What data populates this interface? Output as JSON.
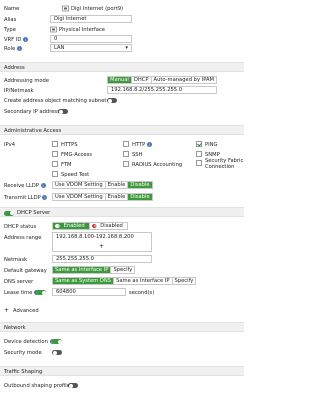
{
  "interface": {
    "name_label": "Name",
    "name_value": "Digi Internet (port9)",
    "alias_label": "Alias",
    "alias_value": "Digi Internet",
    "type_label": "Type",
    "type_value": "Physical Interface",
    "vrf_label": "VRF ID",
    "vrf_value": "0",
    "role_label": "Role",
    "role_value": "LAN"
  },
  "address": {
    "section_title": "Address",
    "mode_label": "Addressing mode",
    "modes": [
      "Manual",
      "DHCP",
      "Auto-managed by IPAM"
    ],
    "ip_label": "IP/Netmask",
    "ip_value": "192.168.8.2/255.255.255.0",
    "create_obj_label": "Create address object matching subnet",
    "secondary_label": "Secondary IP address"
  },
  "admin": {
    "section_title": "Administrative Access",
    "ipv4_label": "IPv4",
    "items": [
      "HTTPS",
      "HTTP",
      "PING",
      "FMG-Access",
      "SSH",
      "SNMP",
      "FTM",
      "RADIUS Accounting",
      "Security Fabric",
      "Connection",
      "Speed Test"
    ],
    "receive_lldp_label": "Receive LLDP",
    "transmit_lldp_label": "Transmit LLDP",
    "lldp_options": [
      "Use VDOM Setting",
      "Enable",
      "Disable"
    ]
  },
  "dhcp": {
    "section_title": "DHCP Server",
    "status_label": "DHCP status",
    "enabled_label": "Enabled",
    "disabled_label": "Disabled",
    "range_label": "Address range",
    "range_value": "192.168.8.100-192.168.8.200",
    "netmask_label": "Netmask",
    "netmask_value": "255.255.255.0",
    "gateway_label": "Default gateway",
    "gateway_options": [
      "Same as Interface IP",
      "Specify"
    ],
    "dns_label": "DNS server",
    "dns_options": [
      "Same as System DNS",
      "Same as Interface IP",
      "Specify"
    ],
    "lease_label": "Lease time",
    "lease_value": "604800",
    "lease_unit": "second(s)",
    "advanced_label": "Advanced"
  },
  "network": {
    "section_title": "Network",
    "device_detection_label": "Device detection",
    "security_mode_label": "Security mode"
  },
  "traffic": {
    "section_title": "Traffic Shaping",
    "outbound_label": "Outbound shaping profile"
  },
  "colors": {
    "accent_green": "#3c9a3c",
    "info_blue": "#4a73b8",
    "disabled_red": "#d32f2f"
  }
}
